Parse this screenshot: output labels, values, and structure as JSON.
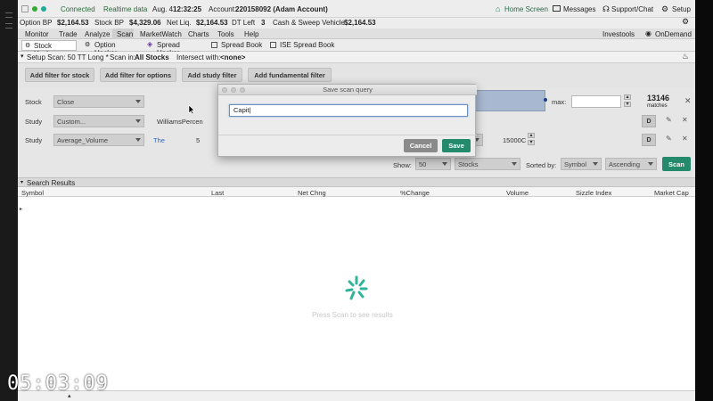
{
  "status": {
    "connected": "Connected",
    "realtime": "Realtime data",
    "date": "Aug. 4",
    "time": "12:32:25",
    "account_label": "Account:",
    "account_value": "220158092 (Adam Account)",
    "home": "Home Screen",
    "messages": "Messages",
    "support": "Support/Chat",
    "setup": "Setup"
  },
  "balances": [
    {
      "label": "Option BP",
      "value": "$2,164.53"
    },
    {
      "label": "Stock BP",
      "value": "$4,329.06"
    },
    {
      "label": "Net Liq.",
      "value": "$2,164.53"
    },
    {
      "label": "DT Left",
      "value": "3"
    },
    {
      "label": "Cash & Sweep Vehicle",
      "value": "$2,164.53"
    }
  ],
  "menu": [
    "Monitor",
    "Trade",
    "Analyze",
    "Scan",
    "MarketWatch",
    "Charts",
    "Tools",
    "Help"
  ],
  "menu_right": {
    "investools": "Investools",
    "ondemand": "OnDemand"
  },
  "tabs": [
    "Stock Hacker",
    "Option Hacker",
    "Spread Hacker",
    "Spread Book",
    "ISE Spread Book"
  ],
  "setup": {
    "setup_scan": "Setup Scan: 50 TT Long *",
    "scan_in_label": "Scan in:",
    "scan_in_value": "All Stocks",
    "intersect_label": "Intersect with:",
    "intersect_value": "<none>"
  },
  "filter_buttons": {
    "stock": "Add filter for stock",
    "options": "Add filter for options",
    "study": "Add study filter",
    "fundamental": "Add fundamental filter"
  },
  "filters": {
    "row1": {
      "label": "Stock",
      "select": "Close",
      "max_label": "max:",
      "matches_count": "13146",
      "matches_label": "matches"
    },
    "row2": {
      "label": "Study",
      "select": "Custom...",
      "study_name": "WilliamsPercen",
      "d_button": "D"
    },
    "row3": {
      "label": "Study",
      "select": "Average_Volume",
      "link": "The",
      "partial_value": "5",
      "value": "15000C",
      "d_button": "D"
    }
  },
  "show": {
    "label": "Show:",
    "count": "50",
    "type": "Stocks",
    "sorted_by_label": "Sorted by:",
    "sort_field": "Symbol",
    "sort_order": "Ascending",
    "scan_button": "Scan"
  },
  "results": {
    "title": "Search Results",
    "columns": [
      "Symbol",
      "Last",
      "Net Chng",
      "%Change",
      "Volume",
      "Sizzle Index",
      "Market Cap"
    ],
    "empty_text": "Press Scan to see results"
  },
  "dialog": {
    "title": "Save scan query",
    "input_value": "Capit|",
    "cancel": "Cancel",
    "save": "Save"
  },
  "timestamp": "05:03:09",
  "colors": {
    "accent_green": "#238a6b",
    "link_blue": "#2a6ad0",
    "spinner": "#2fb39b"
  }
}
